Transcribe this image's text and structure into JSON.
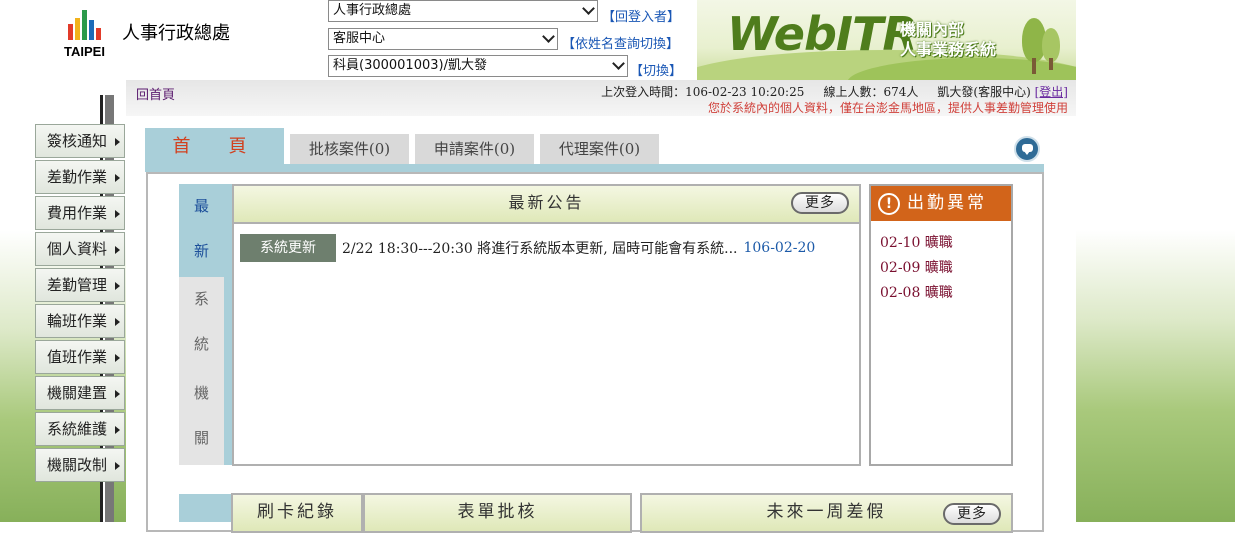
{
  "header": {
    "logo_text": "TAIPEI",
    "org_name": "人事行政總處",
    "selects": [
      {
        "value": "人事行政總處",
        "link": "【回登入者】"
      },
      {
        "value": "客服中心",
        "link": "【依姓名查詢切換】"
      },
      {
        "value": "科員(300001003)/凱大發",
        "link": "【切換】"
      }
    ],
    "banner": {
      "brand": "WebITR",
      "line1": "機關內部",
      "line2": "人事業務系統"
    }
  },
  "topbar": {
    "home": "回首頁",
    "last_login_label": "上次登入時間：106-02-23 10:20:25",
    "online_label": "線上人數：674人",
    "user": "凱大發(客服中心)",
    "logout": "[登出]",
    "notice": "您於系統內的個人資料，僅在台澎金馬地區，提供人事差勤管理使用"
  },
  "sidebar": {
    "items": [
      "簽核通知",
      "差勤作業",
      "費用作業",
      "個人資料",
      "差勤管理",
      "輪班作業",
      "值班作業",
      "機關建置",
      "系統維護",
      "機關改制"
    ]
  },
  "tabs": {
    "active": "首　頁",
    "items": [
      "批核案件(0)",
      "申請案件(0)",
      "代理案件(0)"
    ]
  },
  "vertical_tabs": [
    {
      "chars": [
        "最",
        "新"
      ]
    },
    {
      "chars": [
        "系",
        "統"
      ]
    },
    {
      "chars": [
        "機",
        "關"
      ]
    }
  ],
  "news": {
    "title": "最新公告",
    "more": "更多",
    "items": [
      {
        "badge": "系統更新",
        "text": "2/22 18:30---20:30 將進行系統版本更新, 屆時可能會有系統...",
        "date": "106-02-20"
      }
    ]
  },
  "attendance": {
    "title": "出勤異常",
    "icon": "!",
    "items": [
      "02-10 曠職",
      "02-09 曠職",
      "02-08 曠職"
    ]
  },
  "bottom": {
    "card_record": "刷卡紀錄",
    "form_approve": "表單批核",
    "next_week": "未來一周差假",
    "more": "更多"
  }
}
